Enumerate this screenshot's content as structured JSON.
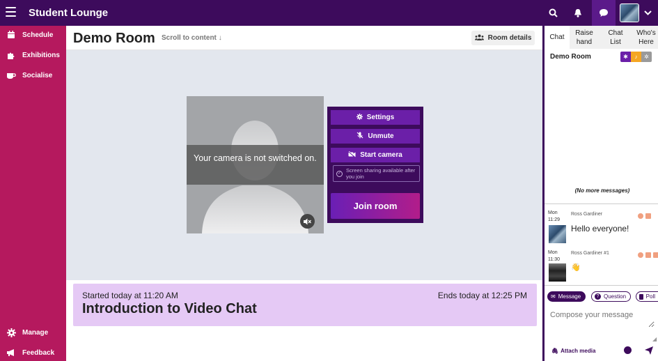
{
  "app": {
    "title": "Student Lounge"
  },
  "colors": {
    "brand": "#3d0b5c",
    "nav": "#b5195e",
    "accent": "#6b1fa8",
    "session_bg": "#e5c9f5"
  },
  "topbar": {
    "icons": [
      "search-icon",
      "bell-icon",
      "chat-bubble-icon",
      "user-avatar",
      "chevron-down-icon"
    ]
  },
  "nav": {
    "items": [
      {
        "label": "Schedule",
        "icon": "calendar-icon"
      },
      {
        "label": "Exhibitions",
        "icon": "puzzle-icon"
      },
      {
        "label": "Socialise",
        "icon": "coffee-icon"
      }
    ],
    "bottom": [
      {
        "label": "Manage",
        "icon": "gear-icon"
      },
      {
        "label": "Feedback",
        "icon": "megaphone-icon"
      }
    ]
  },
  "room": {
    "title": "Demo Room",
    "scroll_link": "Scroll to content",
    "details_label": "Room details"
  },
  "video": {
    "camera_message": "Your camera is not switched on.",
    "settings_label": "Settings",
    "unmute_label": "Unmute",
    "start_camera_label": "Start camera",
    "screen_share_note": "Screen sharing available after you join",
    "join_label": "Join room"
  },
  "session": {
    "started": "Started today at 11:20 AM",
    "ends": "Ends today at 12:25 PM",
    "title": "Introduction to Video Chat"
  },
  "chat": {
    "tabs": [
      {
        "label": "Chat"
      },
      {
        "label": "Raise hand"
      },
      {
        "label": "Chat List"
      },
      {
        "label": "Who's Here"
      }
    ],
    "room_name": "Demo Room",
    "no_more": "(No more messages)",
    "messages": [
      {
        "day": "Mon",
        "time": "11:29",
        "author": "Ross Gardiner",
        "text": "Hello everyone!"
      },
      {
        "day": "Mon",
        "time": "11:30",
        "author": "Ross Gardiner #1",
        "text": "👋"
      }
    ],
    "compose_types": [
      "Message",
      "Question",
      "Poll"
    ],
    "compose_placeholder": "Compose your message",
    "attach_label": "Attach media"
  }
}
